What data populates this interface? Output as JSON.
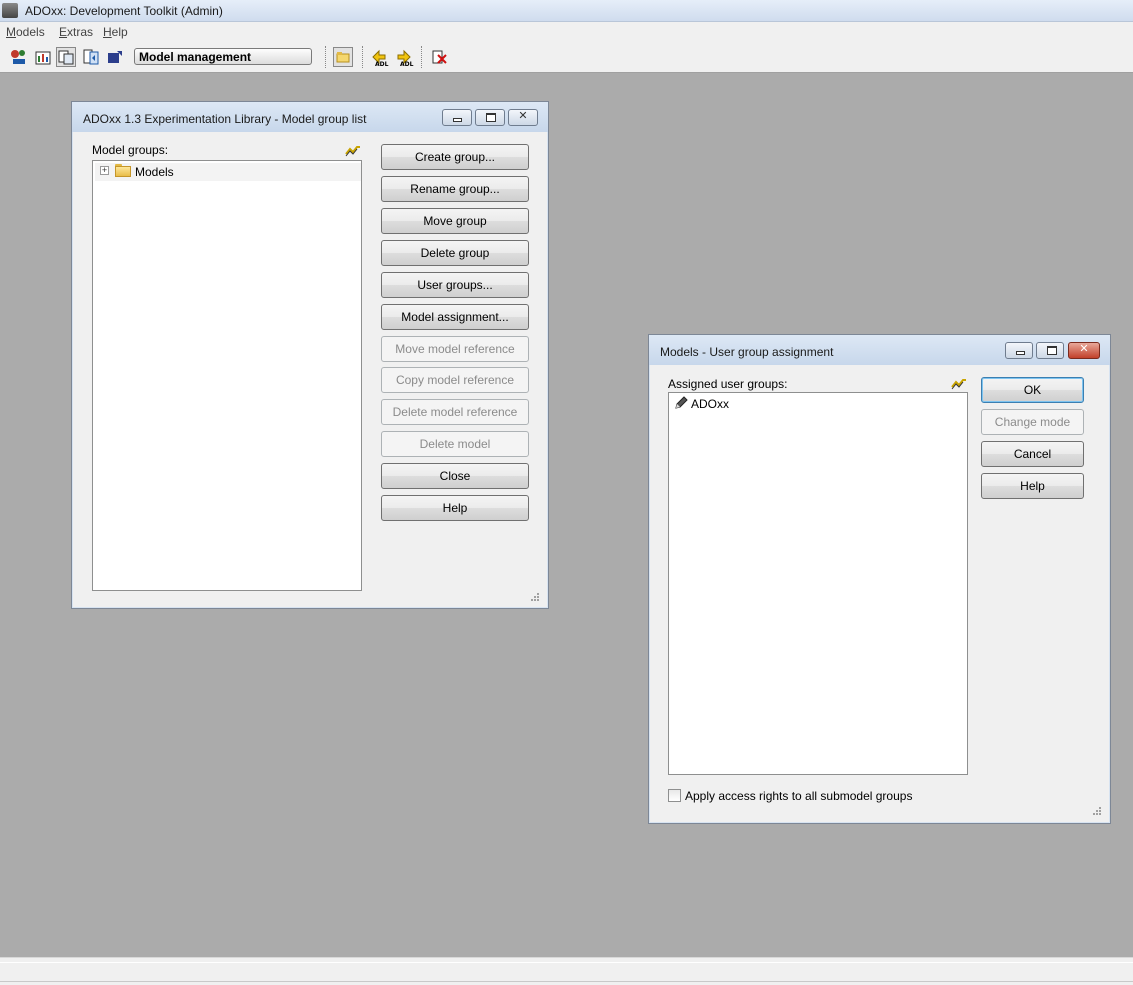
{
  "app": {
    "title": "ADOxx: Development Toolkit (Admin)",
    "menus": [
      "Models",
      "Extras",
      "Help"
    ],
    "component_combo": "Model management"
  },
  "toolbar": {
    "icons": [
      "modelling-icon",
      "analysis-icon",
      "model-management-icon",
      "simulation-icon",
      "import-export-icon",
      "open-models-icon",
      "adl-import-icon",
      "adl-export-icon",
      "delete-model-icon"
    ]
  },
  "group_list_dialog": {
    "title": "ADOxx 1.3 Experimentation Library - Model group list",
    "label": "Model groups:",
    "tree": [
      {
        "label": "Models",
        "expander": "+"
      }
    ],
    "buttons": [
      {
        "label": "Create group...",
        "enabled": true
      },
      {
        "label": "Rename group...",
        "enabled": true
      },
      {
        "label": "Move group",
        "enabled": true
      },
      {
        "label": "Delete group",
        "enabled": true
      },
      {
        "label": "User groups...",
        "enabled": true
      },
      {
        "label": "Model assignment...",
        "enabled": true
      },
      {
        "label": "Move model reference",
        "enabled": false
      },
      {
        "label": "Copy model reference",
        "enabled": false
      },
      {
        "label": "Delete model reference",
        "enabled": false
      },
      {
        "label": "Delete model",
        "enabled": false
      },
      {
        "label": "Close",
        "enabled": true
      },
      {
        "label": "Help",
        "enabled": true
      }
    ]
  },
  "assignment_dialog": {
    "title": "Models - User group assignment",
    "label": "Assigned user groups:",
    "items": [
      {
        "label": "ADOxx",
        "icon": "pencil-icon"
      }
    ],
    "buttons": [
      {
        "label": "OK",
        "enabled": true,
        "default": true
      },
      {
        "label": "Change mode",
        "enabled": false
      },
      {
        "label": "Cancel",
        "enabled": true
      },
      {
        "label": "Help",
        "enabled": true
      }
    ],
    "checkbox": {
      "label": "Apply access rights to all submodel groups",
      "checked": false
    }
  },
  "colors": {
    "workspace": "#ababab",
    "dialog_face": "#f0f0f0",
    "title_gradient_top": "#dde8f5",
    "title_gradient_bottom": "#c7d7eb",
    "disabled_text": "#8b8b8b",
    "close_button_red": "#c2402a"
  }
}
